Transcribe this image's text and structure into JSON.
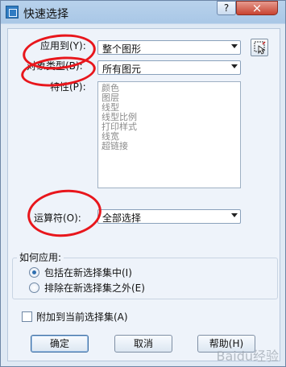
{
  "window": {
    "title": "快速选择",
    "help_label": "?",
    "close_label": "×"
  },
  "fields": {
    "apply_to_label": "应用到(Y):",
    "apply_to_value": "整个图形",
    "object_type_label": "对象类型(B):",
    "object_type_value": "所有图元",
    "properties_label": "特性(P):",
    "properties": [
      "颜色",
      "图层",
      "线型",
      "线型比例",
      "打印样式",
      "线宽",
      "超链接"
    ],
    "operator_label": "运算符(O):",
    "operator_value": "全部选择"
  },
  "apply_group": {
    "title": "如何应用:",
    "options": [
      "包括在新选择集中(I)",
      "排除在新选择集之外(E)"
    ],
    "selected": 0
  },
  "append_checkbox": {
    "label": "附加到当前选择集(A)",
    "checked": false
  },
  "buttons": {
    "ok": "确定",
    "cancel": "取消",
    "help": "帮助(H)"
  },
  "watermark": {
    "text": "Baidu经验"
  },
  "icons": {
    "app": "autocad-app-icon",
    "pick": "select-objects-icon"
  },
  "colors": {
    "annotation": "#e8161c",
    "title_bar": "#b8d2ec"
  }
}
